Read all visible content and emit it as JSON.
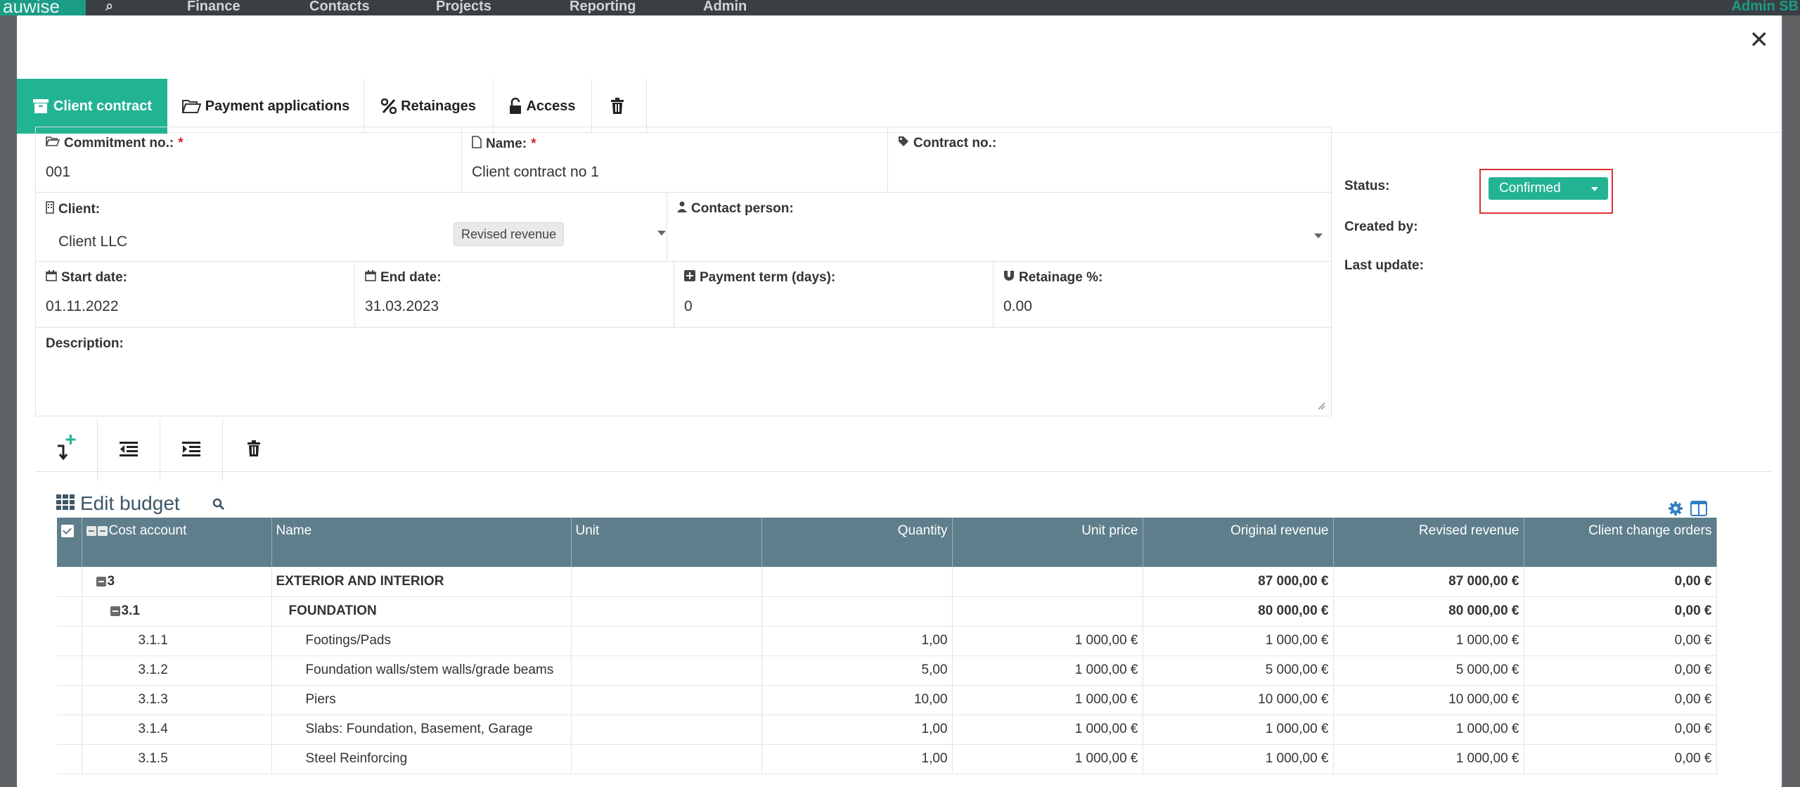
{
  "background": {
    "logo": "auwise",
    "nav": [
      "Finance",
      "Contacts",
      "Projects",
      "Reporting",
      "Admin"
    ],
    "user": "Admin SB"
  },
  "modal": {
    "tabs": [
      {
        "label": "Client contract",
        "icon": "archive-icon"
      },
      {
        "label": "Payment applications",
        "icon": "folder-open-icon"
      },
      {
        "label": "Retainages",
        "icon": "percent-icon"
      },
      {
        "label": "Access",
        "icon": "unlock-icon"
      },
      {
        "label": "",
        "icon": "trash-icon"
      }
    ],
    "form": {
      "commitment_label": "Commitment no.:",
      "commitment_value": "001",
      "name_label": "Name:",
      "name_value": "Client contract no 1",
      "contract_no_label": "Contract no.:",
      "contract_no_value": "",
      "client_label": "Client:",
      "client_value": "Client LLC",
      "contact_label": "Contact person:",
      "contact_value": "",
      "tooltip": "Revised revenue",
      "start_label": "Start date:",
      "start_value": "01.11.2022",
      "end_label": "End date:",
      "end_value": "31.03.2023",
      "payment_label": "Payment term (days):",
      "payment_value": "0",
      "retainage_label": "Retainage %:",
      "retainage_value": "0.00",
      "description_label": "Description:",
      "required_mark": "*"
    },
    "status": {
      "status_label": "Status:",
      "status_value": "Confirmed",
      "created_label": "Created by:",
      "update_label": "Last update:"
    },
    "budget": {
      "title": "Edit budget",
      "columns": [
        "Cost account",
        "Name",
        "Unit",
        "Quantity",
        "Unit price",
        "Original revenue",
        "Revised revenue",
        "Client change orders"
      ],
      "rows": [
        {
          "level": 0,
          "code": "3",
          "name": "EXTERIOR AND INTERIOR",
          "unit": "",
          "qty": "",
          "price": "",
          "orig": "87 000,00 €",
          "rev": "87 000,00 €",
          "co": "0,00 €",
          "bold": true
        },
        {
          "level": 1,
          "code": "3.1",
          "name": "FOUNDATION",
          "unit": "",
          "qty": "",
          "price": "",
          "orig": "80 000,00 €",
          "rev": "80 000,00 €",
          "co": "0,00 €",
          "bold": true
        },
        {
          "level": 2,
          "code": "3.1.1",
          "name": "Footings/Pads",
          "unit": "",
          "qty": "1,00",
          "price": "1 000,00 €",
          "orig": "1 000,00 €",
          "rev": "1 000,00 €",
          "co": "0,00 €",
          "bold": false
        },
        {
          "level": 2,
          "code": "3.1.2",
          "name": "Foundation walls/stem walls/grade beams",
          "unit": "",
          "qty": "5,00",
          "price": "1 000,00 €",
          "orig": "5 000,00 €",
          "rev": "5 000,00 €",
          "co": "0,00 €",
          "bold": false
        },
        {
          "level": 2,
          "code": "3.1.3",
          "name": "Piers",
          "unit": "",
          "qty": "10,00",
          "price": "1 000,00 €",
          "orig": "10 000,00 €",
          "rev": "10 000,00 €",
          "co": "0,00 €",
          "bold": false
        },
        {
          "level": 2,
          "code": "3.1.4",
          "name": "Slabs: Foundation, Basement, Garage",
          "unit": "",
          "qty": "1,00",
          "price": "1 000,00 €",
          "orig": "1 000,00 €",
          "rev": "1 000,00 €",
          "co": "0,00 €",
          "bold": false
        },
        {
          "level": 2,
          "code": "3.1.5",
          "name": "Steel Reinforcing",
          "unit": "",
          "qty": "1,00",
          "price": "1 000,00 €",
          "orig": "1 000,00 €",
          "rev": "1 000,00 €",
          "co": "0,00 €",
          "bold": false
        }
      ]
    }
  },
  "colors": {
    "accent": "#22b393",
    "table_header": "#5e7e8b",
    "highlight": "#e03131"
  }
}
